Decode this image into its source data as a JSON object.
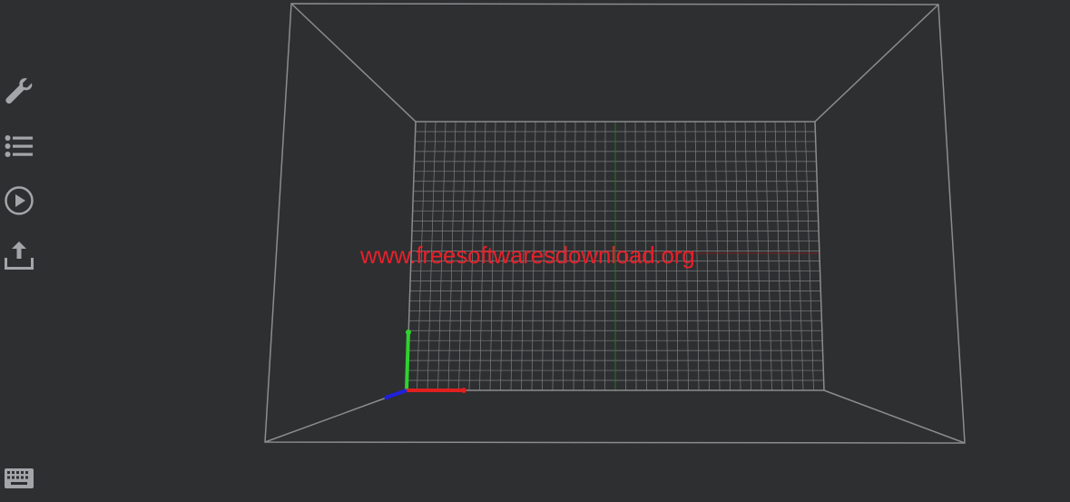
{
  "app": {
    "background_color": "#2d2f31",
    "icon_color": "#a3a5a8",
    "frame_color": "#8c8c8c",
    "grid_color": "#7e7e7e"
  },
  "sidebar": {
    "tools": [
      {
        "icon": "wrench-icon",
        "name": "settings"
      },
      {
        "icon": "list-icon",
        "name": "list"
      },
      {
        "icon": "play-icon",
        "name": "play"
      },
      {
        "icon": "upload-icon",
        "name": "export"
      }
    ],
    "bottom_tool": {
      "icon": "keyboard-icon",
      "name": "keyboard"
    }
  },
  "viewport": {
    "watermark_text": "www.freesoftwaresdownload.org",
    "watermark_color": "#e8202a",
    "axes": {
      "x_color": "#e01f1f",
      "y_color": "#2fd22f",
      "z_color": "#2020e0"
    }
  }
}
